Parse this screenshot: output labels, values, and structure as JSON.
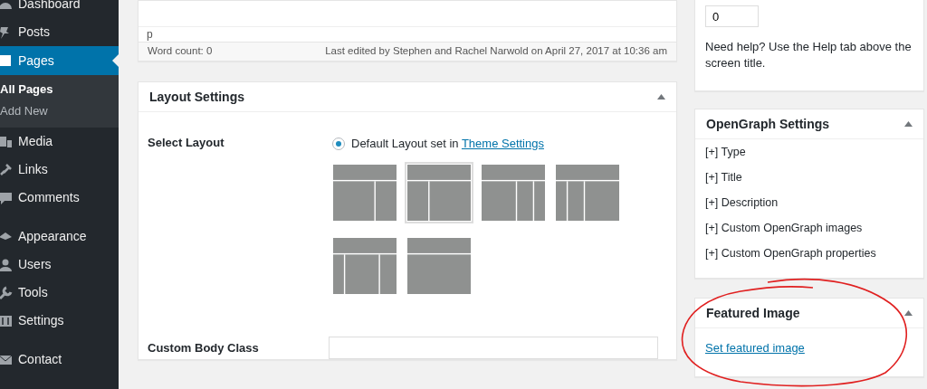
{
  "sidebar": {
    "items": [
      {
        "label": "Dashboard",
        "selected": false
      },
      {
        "label": "Posts",
        "selected": false
      },
      {
        "label": "Pages",
        "selected": true,
        "children": [
          {
            "label": "All Pages",
            "selected": true
          },
          {
            "label": "Add New",
            "selected": false
          }
        ]
      },
      {
        "label": "Media",
        "selected": false
      },
      {
        "label": "Links",
        "selected": false
      },
      {
        "label": "Comments",
        "selected": false
      },
      {
        "label": "Appearance",
        "selected": false
      },
      {
        "label": "Users",
        "selected": false
      },
      {
        "label": "Tools",
        "selected": false
      },
      {
        "label": "Settings",
        "selected": false
      },
      {
        "label": "Contact",
        "selected": false
      }
    ]
  },
  "editor": {
    "path": "p",
    "word_count": "Word count: 0",
    "last_edited": "Last edited by Stephen and Rachel Narwold on April 27, 2017 at 10:36 am"
  },
  "layout_settings": {
    "title": "Layout Settings",
    "select_label": "Select Layout",
    "default_option": {
      "text": "Default Layout set in ",
      "link": "Theme Settings",
      "selected": true
    },
    "layouts": [
      {
        "kind": "content-sidebar",
        "selected": false
      },
      {
        "kind": "sidebar-content",
        "selected": true
      },
      {
        "kind": "content-sidebar-sidebar",
        "selected": false
      },
      {
        "kind": "sidebar-sidebar-content",
        "selected": false
      },
      {
        "kind": "sidebar-content-sidebar",
        "selected": false
      },
      {
        "kind": "full-width",
        "selected": false
      }
    ],
    "body_class_label": "Custom Body Class"
  },
  "page_attributes": {
    "order": "0",
    "help": "Need help? Use the Help tab above the screen title."
  },
  "opengraph": {
    "title": "OpenGraph Settings",
    "items": [
      "[+] Type",
      "[+] Title",
      "[+] Description",
      "[+] Custom OpenGraph images",
      "[+] Custom OpenGraph properties"
    ]
  },
  "featured_image": {
    "title": "Featured Image",
    "link": "Set featured image"
  },
  "annotation": {
    "kind": "circle",
    "color": "#e02020"
  }
}
